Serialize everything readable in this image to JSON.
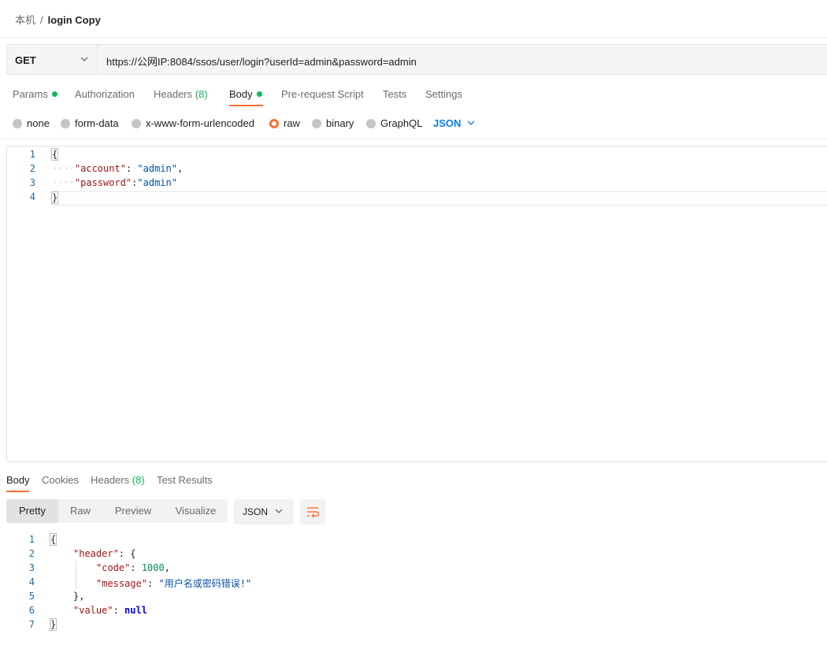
{
  "breadcrumb": {
    "parent": "本机",
    "separator": "/",
    "current": "login Copy"
  },
  "request": {
    "method": "GET",
    "url": "https://公网IP:8084/ssos/user/login?userId=admin&password=admin"
  },
  "request_tabs": [
    {
      "label": "Params",
      "dot": true
    },
    {
      "label": "Authorization"
    },
    {
      "label": "Headers",
      "count": "(8)"
    },
    {
      "label": "Body",
      "dot": true,
      "active": true
    },
    {
      "label": "Pre-request Script"
    },
    {
      "label": "Tests"
    },
    {
      "label": "Settings"
    }
  ],
  "body_types": [
    {
      "label": "none"
    },
    {
      "label": "form-data"
    },
    {
      "label": "x-www-form-urlencoded"
    },
    {
      "label": "raw",
      "selected": true
    },
    {
      "label": "binary"
    },
    {
      "label": "GraphQL"
    }
  ],
  "body_language": "JSON",
  "request_body": {
    "line_numbers": [
      "1",
      "2",
      "3",
      "4"
    ],
    "open_brace": "{",
    "line2_ws": "····",
    "line2_key": "\"account\"",
    "line2_colon": ":",
    "line2_ws2": "·",
    "line2_value": "\"admin\"",
    "line2_comma": ",",
    "line3_ws": "····",
    "line3_key": "\"password\"",
    "line3_colon": ":",
    "line3_value": "\"admin\"",
    "close_brace": "}"
  },
  "response_tabs": [
    {
      "label": "Body",
      "active": true
    },
    {
      "label": "Cookies"
    },
    {
      "label": "Headers",
      "count": "(8)"
    },
    {
      "label": "Test Results"
    }
  ],
  "response_views": [
    "Pretty",
    "Raw",
    "Preview",
    "Visualize"
  ],
  "response_format": "JSON",
  "response_body": {
    "line_numbers": [
      "1",
      "2",
      "3",
      "4",
      "5",
      "6",
      "7"
    ],
    "open_brace": "{",
    "header_key": "\"header\"",
    "header_open": "{",
    "code_key": "\"code\"",
    "code_value": "1000",
    "message_key": "\"message\"",
    "message_value": "\"用户名或密码错误!\"",
    "header_close": "},",
    "value_key": "\"value\"",
    "value_value": "null",
    "close_brace": "}"
  },
  "colors": {
    "accent": "#ff6c37",
    "green": "#0cbb52",
    "link_blue": "#097bed"
  }
}
